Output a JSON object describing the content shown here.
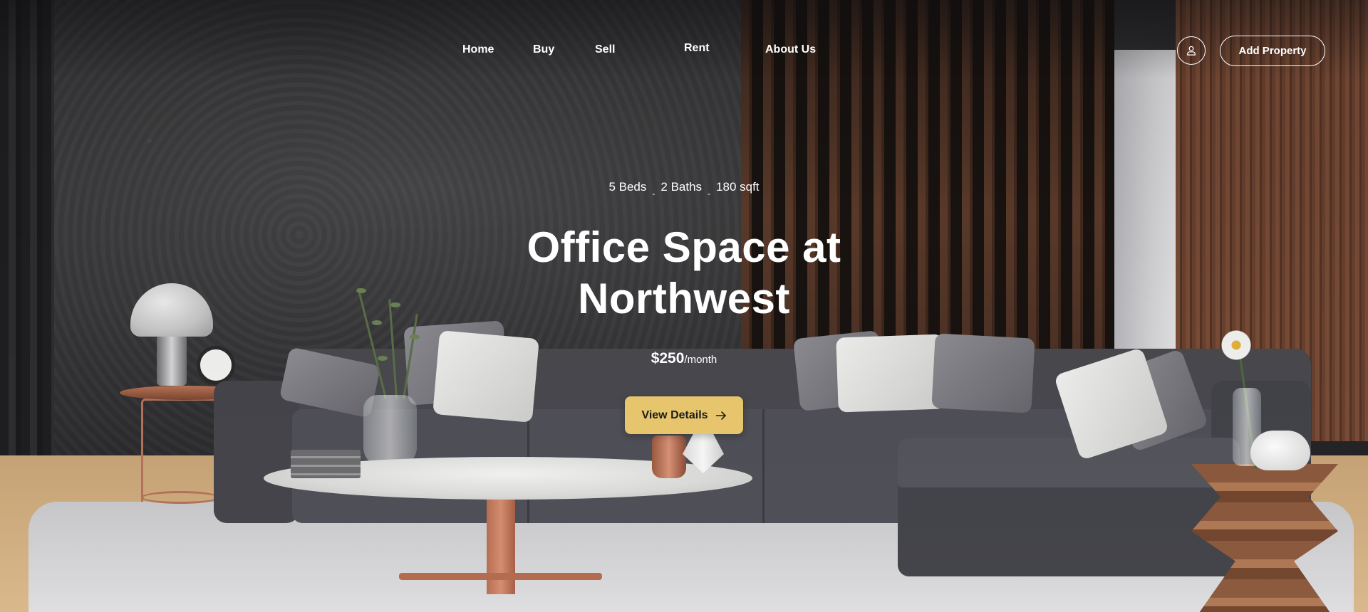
{
  "nav": {
    "links": [
      {
        "label": "Home"
      },
      {
        "label": "Buy"
      },
      {
        "label": "Sell"
      },
      {
        "label": "Rent"
      },
      {
        "label": "About Us"
      }
    ],
    "user_icon": "user-icon",
    "add_property_label": "Add Property"
  },
  "hero": {
    "specs": {
      "beds": "5 Beds",
      "baths": "2 Baths",
      "area": "180 sqft",
      "separator": "-"
    },
    "title_line1": "Office Space at",
    "title_line2": "Northwest",
    "price": {
      "amount": "$250",
      "unit": "/month"
    },
    "cta": {
      "label": "View Details",
      "icon": "arrow-right-icon"
    }
  },
  "colors": {
    "accent": "#e6c56c",
    "text": "#ffffff",
    "cta_text": "#1c1c1c"
  }
}
